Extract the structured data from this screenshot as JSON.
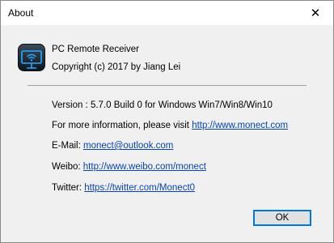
{
  "window": {
    "title": "About",
    "close_glyph": "✕"
  },
  "app": {
    "name": "PC Remote Receiver",
    "copyright": "Copyright (c) 2017 by Jiang Lei",
    "icon": "monitor-wifi-icon"
  },
  "info": {
    "version": "Version : 5.7.0 Build 0 for Windows Win7/Win8/Win10",
    "more_info_label": "For more information, please visit ",
    "more_info_link": "http://www.monect.com",
    "email_label": "E-Mail: ",
    "email_link": "monect@outlook.com",
    "weibo_label": "Weibo: ",
    "weibo_link": "http://www.weibo.com/monect",
    "twitter_label": "Twitter: ",
    "twitter_link": "https://twitter.com/Monect0"
  },
  "buttons": {
    "ok": "OK"
  },
  "colors": {
    "link": "#0645ad",
    "button_focus_border": "#0078d7",
    "dialog_bg": "#f0f0f0"
  }
}
